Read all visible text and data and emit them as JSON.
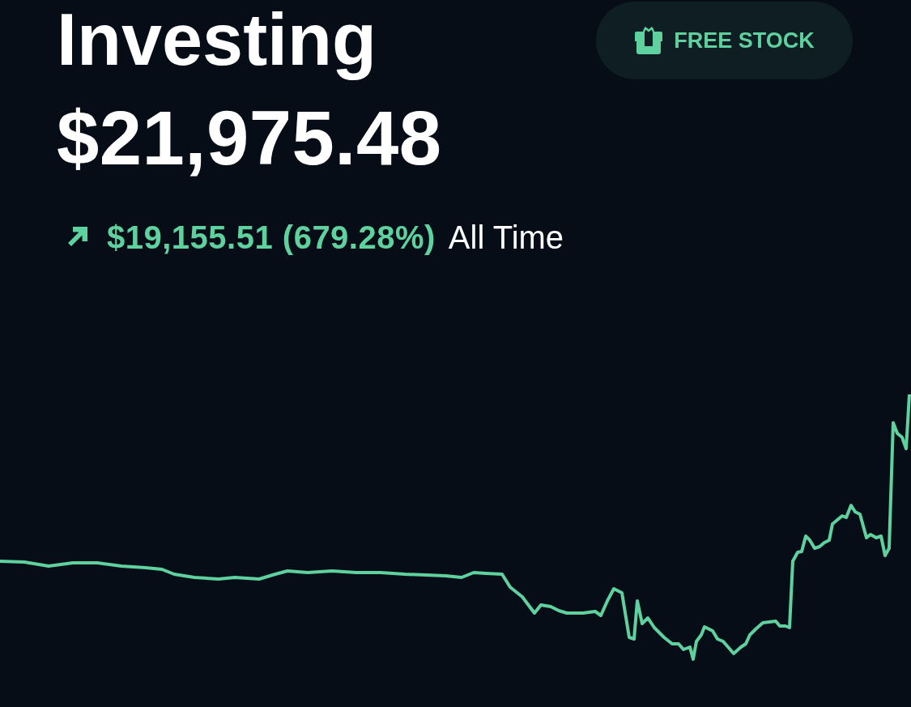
{
  "header": {
    "title": "Investing",
    "portfolio_value": "$21,975.48"
  },
  "free_stock_button": {
    "label": "FREE STOCK"
  },
  "change": {
    "positive": true,
    "amount": "$19,155.51 (679.28%)",
    "period": "All Time"
  }
}
